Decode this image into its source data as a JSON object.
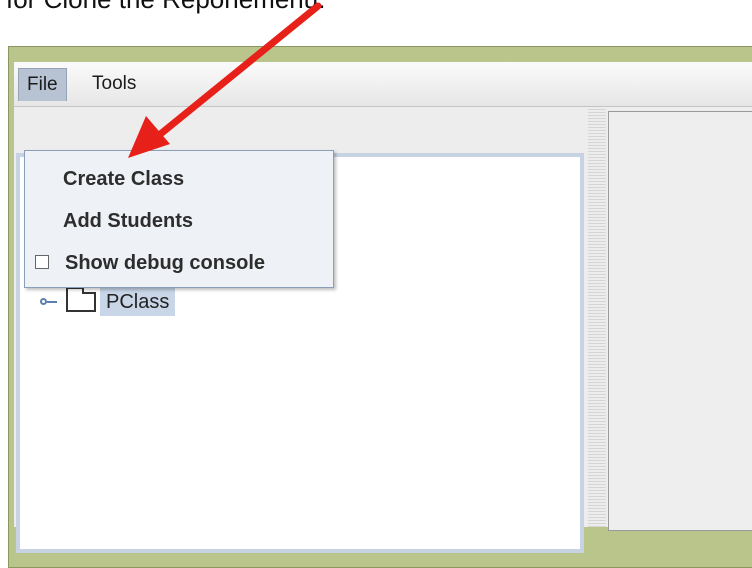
{
  "caption": "for Clone the Reponemenu:",
  "menubar": {
    "file_label": "File",
    "tools_label": "Tools"
  },
  "file_menu": {
    "items": [
      {
        "label": "Create Class"
      },
      {
        "label": "Add Students"
      },
      {
        "label": "Show debug console",
        "checkbox": true,
        "checked": false
      }
    ]
  },
  "tree": {
    "nodes": [
      {
        "label": "PClass",
        "selected": true
      }
    ]
  },
  "colors": {
    "arrow": "#e8201a",
    "titlebar": "#b9c58a",
    "selection": "#c8d6e8"
  }
}
